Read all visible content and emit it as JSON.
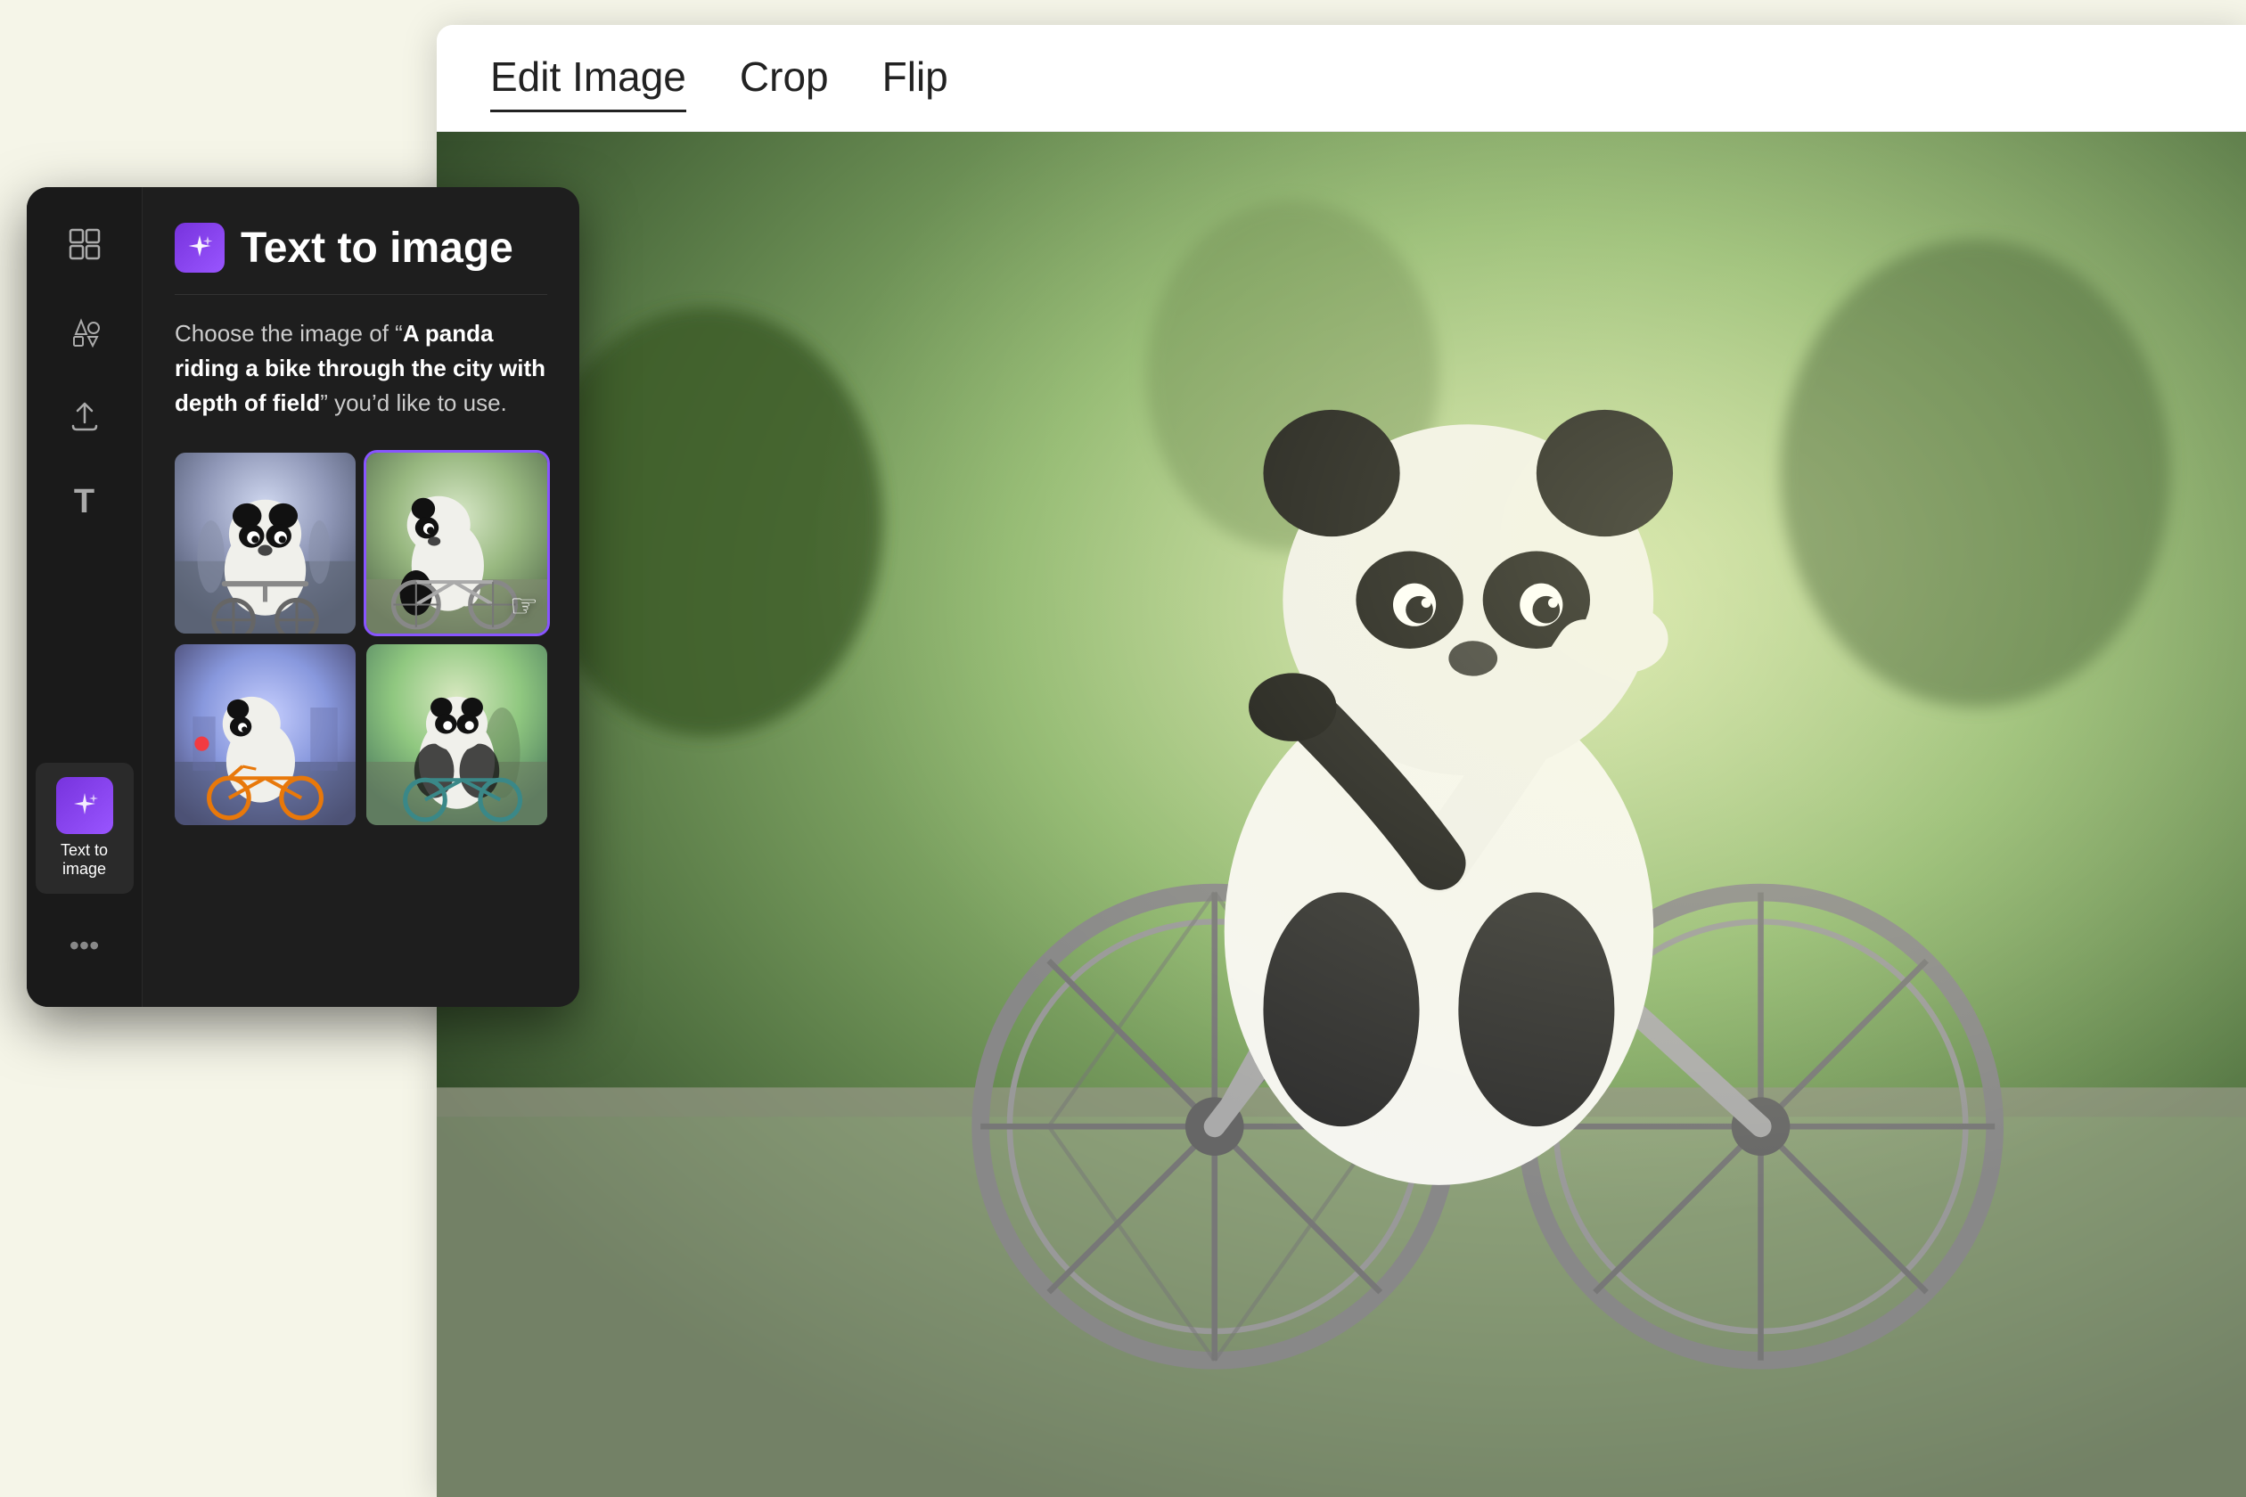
{
  "app": {
    "background_color": "#f5f5e8"
  },
  "toolbar": {
    "tabs": [
      {
        "id": "edit-image",
        "label": "Edit Image",
        "active": true
      },
      {
        "id": "crop",
        "label": "Crop",
        "active": false
      },
      {
        "id": "flip",
        "label": "Flip",
        "active": false
      }
    ]
  },
  "sidebar": {
    "rail_items": [
      {
        "id": "layout",
        "icon": "⊞",
        "label": "",
        "active": false
      },
      {
        "id": "elements",
        "icon": "♡△□◇",
        "label": "",
        "active": false
      },
      {
        "id": "upload",
        "icon": "↑",
        "label": "",
        "active": false
      },
      {
        "id": "text",
        "icon": "T",
        "label": "",
        "active": false
      },
      {
        "id": "text-to-image",
        "icon": "✦",
        "label": "Text to image",
        "active": true
      }
    ],
    "more_label": "•••"
  },
  "panel": {
    "icon": "✦",
    "title": "Text to image",
    "description_prefix": "Choose the image of “",
    "description_bold": "A panda riding a bike through the city with depth of field",
    "description_suffix": "” you’d like to use.",
    "images": [
      {
        "id": 1,
        "alt": "Panda riding bike on city street, front view"
      },
      {
        "id": 2,
        "alt": "Panda riding bike, side view, minimalist style",
        "selected": true
      },
      {
        "id": 3,
        "alt": "Panda riding orange bike in colorful city"
      },
      {
        "id": 4,
        "alt": "Panda riding bike, low angle city view"
      }
    ]
  },
  "cursor": {
    "symbol": "☞"
  }
}
